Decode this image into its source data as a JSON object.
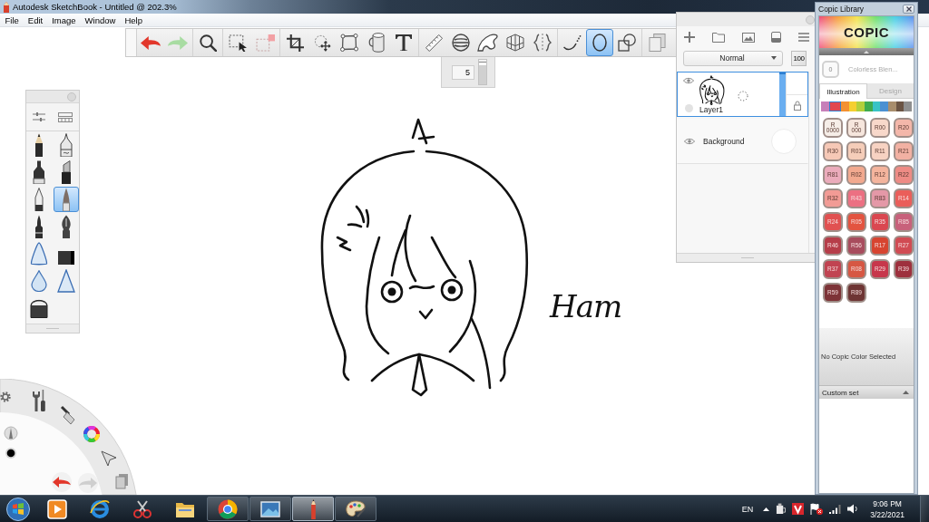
{
  "window": {
    "title": "Autodesk SketchBook - Untitled @ 202.3%"
  },
  "menu": [
    "File",
    "Edit",
    "Image",
    "Window",
    "Help"
  ],
  "toolbar": {
    "groups": [
      {
        "tools": [
          {
            "selected": false
          },
          {
            "selected": false
          }
        ]
      },
      {
        "tools": [
          {
            "selected": false
          }
        ]
      },
      {
        "tools": [
          {
            "selected": false
          },
          {
            "selected": false
          }
        ]
      },
      {
        "tools": [
          {
            "selected": false
          },
          {
            "selected": false
          },
          {
            "selected": false
          },
          {
            "selected": false
          },
          {
            "selected": false
          }
        ]
      },
      {
        "tools": [
          {
            "selected": false
          },
          {
            "selected": false
          },
          {
            "selected": false
          },
          {
            "selected": false
          },
          {
            "selected": false
          }
        ]
      },
      {
        "tools": [
          {
            "selected": false
          },
          {
            "selected": true
          },
          {
            "selected": false
          }
        ]
      },
      {
        "tools": [
          {
            "selected": false
          }
        ]
      }
    ]
  },
  "brush_size": {
    "value": "5",
    "level": 0.9
  },
  "canvas": {
    "signature": "Ham"
  },
  "brush_palette": {
    "brushes": [
      {
        "selected": false
      },
      {
        "selected": false
      },
      {
        "selected": false
      },
      {
        "selected": false
      },
      {
        "selected": false
      },
      {
        "selected": true
      },
      {
        "selected": false
      },
      {
        "selected": false
      },
      {
        "selected": false
      },
      {
        "selected": false
      },
      {
        "selected": false
      },
      {
        "selected": false
      },
      {
        "selected": false
      }
    ]
  },
  "layers": {
    "blend_mode": "Normal",
    "opacity": "100",
    "items": [
      {
        "kind": "paint",
        "name": "Layer1",
        "selected": true,
        "visible": true,
        "level": 1
      },
      {
        "kind": "background",
        "name": "Background",
        "selected": false,
        "visible": true
      }
    ]
  },
  "copic": {
    "title": "Copic Library",
    "logo": "COPIC",
    "blender": {
      "code": "0",
      "name": "Colorless Blen..."
    },
    "tabs": [
      {
        "label": "Illustration",
        "selected": true
      },
      {
        "label": "Design",
        "selected": false
      }
    ],
    "families": [
      {
        "color": "#c77fb9",
        "selected": false
      },
      {
        "color": "#e2474f",
        "selected": true
      },
      {
        "color": "#f39131",
        "selected": false
      },
      {
        "color": "#f5cf2f",
        "selected": false
      },
      {
        "color": "#b3cf3b",
        "selected": false
      },
      {
        "color": "#3eab4f",
        "selected": false
      },
      {
        "color": "#38c3c6",
        "selected": false
      },
      {
        "color": "#4b90d2",
        "selected": false
      },
      {
        "color": "#a88d6c",
        "selected": false
      },
      {
        "color": "#6b5444",
        "selected": false
      },
      {
        "color": "#8f8f8f",
        "selected": false
      }
    ],
    "swatches": [
      {
        "code": "R 0000",
        "color": "#f6eee8"
      },
      {
        "code": "R 000",
        "color": "#f6e6dd"
      },
      {
        "code": "R00",
        "color": "#f8d8ca"
      },
      {
        "code": "R20",
        "color": "#f4b7aa"
      },
      {
        "code": "R30",
        "color": "#f6c8b6"
      },
      {
        "code": "R01",
        "color": "#f5cdb9"
      },
      {
        "code": "R11",
        "color": "#f7d2c2"
      },
      {
        "code": "R21",
        "color": "#f2b1a3"
      },
      {
        "code": "R81",
        "color": "#ebabbb"
      },
      {
        "code": "R02",
        "color": "#f2a98f"
      },
      {
        "code": "R12",
        "color": "#f4b49d"
      },
      {
        "code": "R22",
        "color": "#ee8b85"
      },
      {
        "code": "R32",
        "color": "#f29b95"
      },
      {
        "code": "R43",
        "color": "#ec7082"
      },
      {
        "code": "R83",
        "color": "#e498a7"
      },
      {
        "code": "R14",
        "color": "#ea5e5a"
      },
      {
        "code": "R24",
        "color": "#e15151"
      },
      {
        "code": "R05",
        "color": "#e35440"
      },
      {
        "code": "R35",
        "color": "#da4750"
      },
      {
        "code": "R85",
        "color": "#c8617b"
      },
      {
        "code": "R46",
        "color": "#b63d49"
      },
      {
        "code": "R56",
        "color": "#a84c5d"
      },
      {
        "code": "R17",
        "color": "#d74430"
      },
      {
        "code": "R27",
        "color": "#d14b53"
      },
      {
        "code": "R37",
        "color": "#c14351"
      },
      {
        "code": "R08",
        "color": "#d65743"
      },
      {
        "code": "R29",
        "color": "#c7374b"
      },
      {
        "code": "R39",
        "color": "#9e303d"
      },
      {
        "code": "R59",
        "color": "#7d3337"
      },
      {
        "code": "R89",
        "color": "#6e3534"
      }
    ],
    "status": "No Copic Color Selected",
    "custom_set": "Custom set"
  },
  "taskbar": {
    "apps": [
      {
        "running": false,
        "selected": false
      },
      {
        "running": false,
        "selected": false
      },
      {
        "running": false,
        "selected": false
      },
      {
        "running": false,
        "selected": false
      },
      {
        "running": true,
        "selected": false
      },
      {
        "running": true,
        "selected": false
      },
      {
        "running": true,
        "selected": true
      },
      {
        "running": true,
        "selected": false
      }
    ],
    "language": "EN",
    "time": "9:06 PM",
    "date": "3/22/2021"
  }
}
